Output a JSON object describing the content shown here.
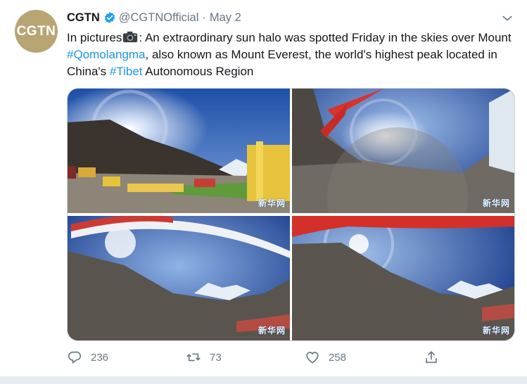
{
  "account": {
    "avatar_text": "CGTN",
    "name": "CGTN",
    "handle": "@CGTNOfficial",
    "separator": "·",
    "date": "May 2"
  },
  "tweet": {
    "prefix": "In pictures",
    "part1": ": An extraordinary sun halo was spotted Friday in the skies over Mount ",
    "hashtag1": "#Qomolangma",
    "part2": ", also known as Mount Everest, the world's highest peak located in China's ",
    "hashtag2": "#Tibet",
    "part3": " Autonomous Region"
  },
  "media": {
    "watermark": "新华网"
  },
  "actions": {
    "reply_count": "236",
    "retweet_count": "73",
    "like_count": "258"
  },
  "icons": [
    "verified-badge-icon",
    "chevron-down-icon",
    "camera-icon",
    "reply-icon",
    "retweet-icon",
    "like-icon",
    "share-icon"
  ],
  "colors": {
    "link": "#1b95e0",
    "muted": "#657786",
    "verified": "#1da1f2",
    "avatar": "#b8a574"
  }
}
